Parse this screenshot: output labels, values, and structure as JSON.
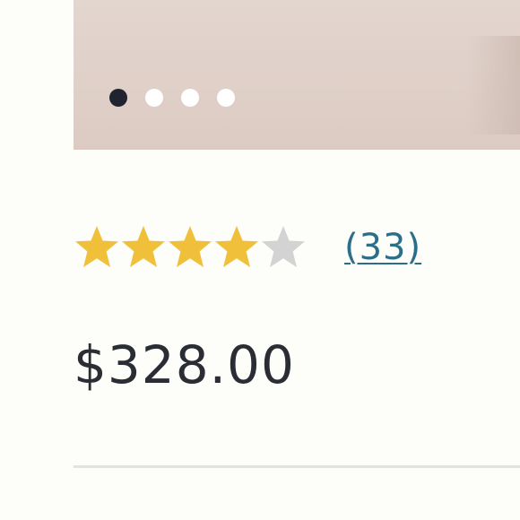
{
  "carousel": {
    "dot_count": 4,
    "active_index": 0
  },
  "rating": {
    "value": 4,
    "max": 5,
    "review_count_label": "(33)",
    "filled_color": "#f0c03a",
    "empty_color": "#d3d3d3"
  },
  "price": {
    "text": "$328.00"
  },
  "colors": {
    "link": "#2b6e8a",
    "text": "#2a2d33",
    "active_dot": "#1f2430"
  }
}
